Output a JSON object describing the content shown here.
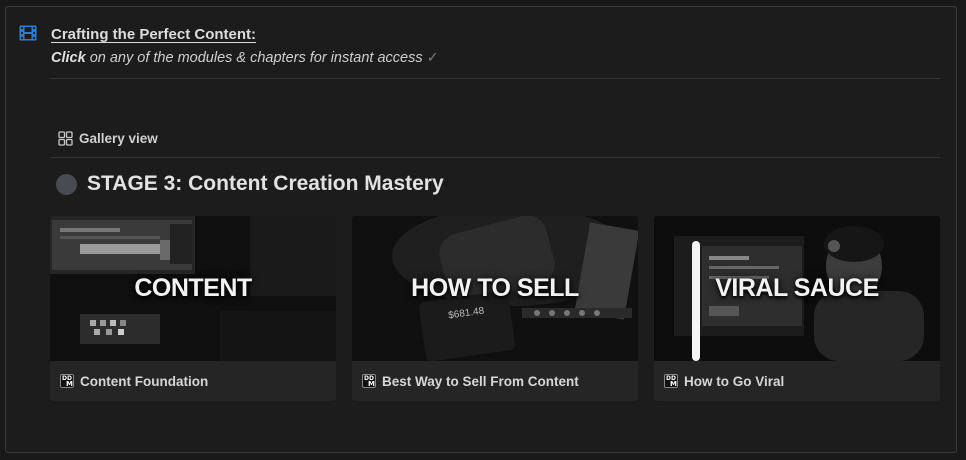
{
  "header": {
    "title": "Crafting the Perfect Content:",
    "subtitle_bold": "Click",
    "subtitle_rest": " on any of the modules & chapters for instant access",
    "check_glyph": "✓",
    "icon": "film-icon"
  },
  "view": {
    "label": "Gallery view",
    "icon": "gallery-grid-icon"
  },
  "stage": {
    "title": "STAGE 3: Content Creation Mastery"
  },
  "cards": [
    {
      "cover_text": "CONTENT",
      "title": "Content Foundation",
      "icon": "dm-page-icon"
    },
    {
      "cover_text": "HOW TO SELL",
      "title": "Best Way to Sell From Content",
      "icon": "dm-page-icon"
    },
    {
      "cover_text": "VIRAL SAUCE",
      "title": "How to Go Viral",
      "icon": "dm-page-icon"
    }
  ],
  "colors": {
    "accent_blue": "#2e7bd6",
    "background": "#191919",
    "card_background": "#252525",
    "stage_dot": "#474b52"
  }
}
